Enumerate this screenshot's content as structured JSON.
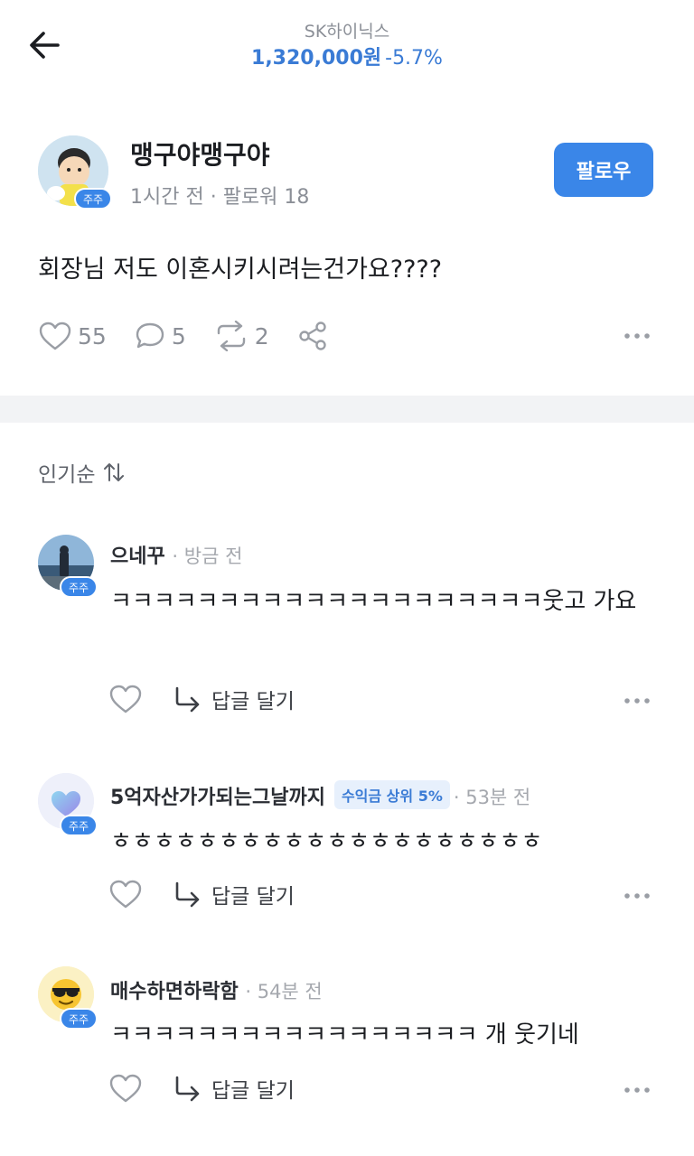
{
  "header": {
    "stock_name": "SK하이닉스",
    "price": "1,320,000원",
    "change": "-5.7%"
  },
  "post": {
    "author": "맹구야맹구야",
    "badge": "주주",
    "meta": "1시간 전 · 팔로워 18",
    "follow_label": "팔로우",
    "body": "회장님 저도 이혼시키시려는건가요????",
    "likes": "55",
    "comments": "5",
    "reposts": "2"
  },
  "sort_label": "인기순",
  "comments": [
    {
      "name": "으네꾸",
      "time": "· 방금 전",
      "badge": "주주",
      "text": "ㅋㅋㅋㅋㅋㅋㅋㅋㅋㅋㅋㅋㅋㅋㅋㅋㅋㅋㅋㅋ웃고 가요",
      "reply_label": "답글 달기"
    },
    {
      "name": "5억자산가가되는그날까지",
      "rank": "수익금 상위 5%",
      "time": "· 53분 전",
      "badge": "주주",
      "text": "ㅎㅎㅎㅎㅎㅎㅎㅎㅎㅎㅎㅎㅎㅎㅎㅎㅎㅎㅎㅎ",
      "reply_label": "답글 달기"
    },
    {
      "name": "매수하면하락함",
      "time": "· 54분 전",
      "badge": "주주",
      "text": "ㅋㅋㅋㅋㅋㅋㅋㅋㅋㅋㅋㅋㅋㅋㅋㅋㅋ 개 웃기네",
      "reply_label": "답글 달기"
    }
  ],
  "colors": {
    "accent": "#3a86e8",
    "price": "#3a7bd5",
    "muted": "#8b8f97",
    "divider": "#f2f3f5"
  },
  "icons": [
    "back-arrow-icon",
    "heart-icon",
    "comment-icon",
    "repost-icon",
    "share-icon",
    "more-icon",
    "sort-icon",
    "reply-arrow-icon"
  ]
}
